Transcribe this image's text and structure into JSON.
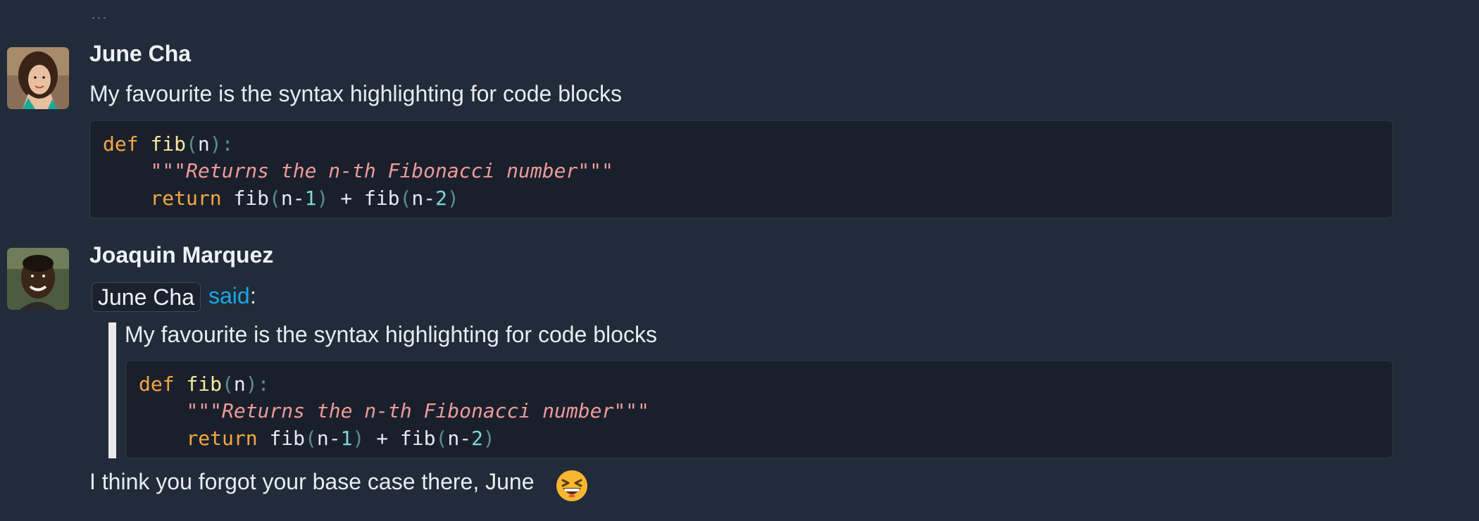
{
  "messages": [
    {
      "author": "June Cha",
      "text": "My favourite is the syntax highlighting for code blocks",
      "code": {
        "line1": {
          "kw": "def",
          "fn": "fib",
          "open": "(",
          "arg": "n",
          "close": "):"
        },
        "line2": {
          "quote_open": "\"\"\"",
          "doc": "Returns the n-th Fibonacci number",
          "quote_close": "\"\"\""
        },
        "line3": {
          "kw": "return",
          "fn1": "fib",
          "open1": "(",
          "n1": "n-",
          "num1": "1",
          "close1": ")",
          "plus": "+",
          "fn2": "fib",
          "open2": "(",
          "n2": "n-",
          "num2": "2",
          "close2": ")"
        }
      }
    },
    {
      "author": "Joaquin Marquez",
      "mention": "June Cha",
      "said_link": "said",
      "colon": ":",
      "quote": {
        "text": "My favourite is the syntax highlighting for code blocks",
        "code": {
          "line1": {
            "kw": "def",
            "fn": "fib",
            "open": "(",
            "arg": "n",
            "close": "):"
          },
          "line2": {
            "quote_open": "\"\"\"",
            "doc": "Returns the n-th Fibonacci number",
            "quote_close": "\"\"\""
          },
          "line3": {
            "kw": "return",
            "fn1": "fib",
            "open1": "(",
            "n1": "n-",
            "num1": "1",
            "close1": ")",
            "plus": "+",
            "fn2": "fib",
            "open2": "(",
            "n2": "n-",
            "num2": "2",
            "close2": ")"
          }
        }
      },
      "reply": "I think you forgot your base case there, June"
    }
  ],
  "emoji": "grinning-squinting-face",
  "colors": {
    "background": "#212b39",
    "code_background": "#1a202b",
    "keyword": "#f5a742",
    "function": "#f7e99b",
    "docstring": "#ee9a9a",
    "number": "#7fd6d8",
    "link": "#1aa6e8"
  }
}
